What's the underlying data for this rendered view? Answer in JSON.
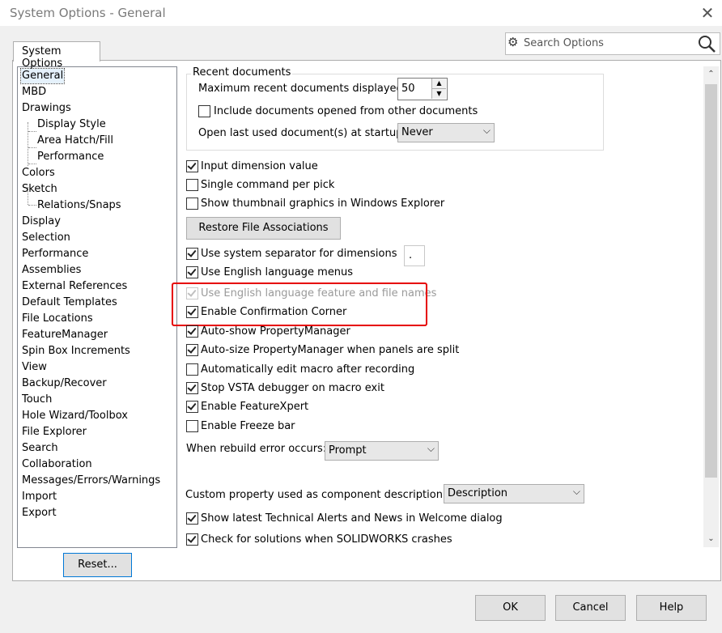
{
  "window": {
    "title": "System Options - General"
  },
  "tab": {
    "label": "System Options"
  },
  "search": {
    "placeholder": "Search Options"
  },
  "tree": {
    "items": [
      "General",
      "MBD",
      "Drawings",
      "Display Style",
      "Area Hatch/Fill",
      "Performance",
      "Colors",
      "Sketch",
      "Relations/Snaps",
      "Display",
      "Selection",
      "Performance",
      "Assemblies",
      "External References",
      "Default Templates",
      "File Locations",
      "FeatureManager",
      "Spin Box Increments",
      "View",
      "Backup/Recover",
      "Touch",
      "Hole Wizard/Toolbox",
      "File Explorer",
      "Search",
      "Collaboration",
      "Messages/Errors/Warnings",
      "Import",
      "Export"
    ],
    "selected": "General"
  },
  "reset_button": "Reset...",
  "recent": {
    "group_title": "Recent documents",
    "max_label": "Maximum recent documents displayed:",
    "max_value": "50",
    "include_label": "Include documents opened from other documents",
    "open_last_label": "Open last used document(s) at startup:",
    "open_last_value": "Never"
  },
  "options": {
    "input_dimension": "Input dimension value",
    "single_command": "Single command per pick",
    "show_thumbnail": "Show thumbnail graphics in Windows Explorer",
    "restore_button": "Restore File Associations",
    "system_separator": "Use system separator for dimensions",
    "separator_value": ".",
    "english_menus": "Use English language menus",
    "english_feature": "Use English language feature and file names",
    "confirmation_corner": "Enable Confirmation Corner",
    "autoshow_pm": "Auto-show PropertyManager",
    "autosize_pm": "Auto-size PropertyManager when panels are split",
    "auto_edit_macro": "Automatically edit macro after recording",
    "stop_vsta": "Stop VSTA debugger on macro exit",
    "feature_xpert": "Enable FeatureXpert",
    "freeze_bar": "Enable Freeze bar",
    "rebuild_error_label": "When rebuild error occurs:",
    "rebuild_error_value": "Prompt",
    "custom_property_label": "Custom property used as component description:",
    "custom_property_value": "Description",
    "show_alerts": "Show latest Technical Alerts and News in Welcome dialog",
    "check_solutions": "Check for solutions when SOLIDWORKS crashes"
  },
  "footer": {
    "ok": "OK",
    "cancel": "Cancel",
    "help": "Help"
  }
}
